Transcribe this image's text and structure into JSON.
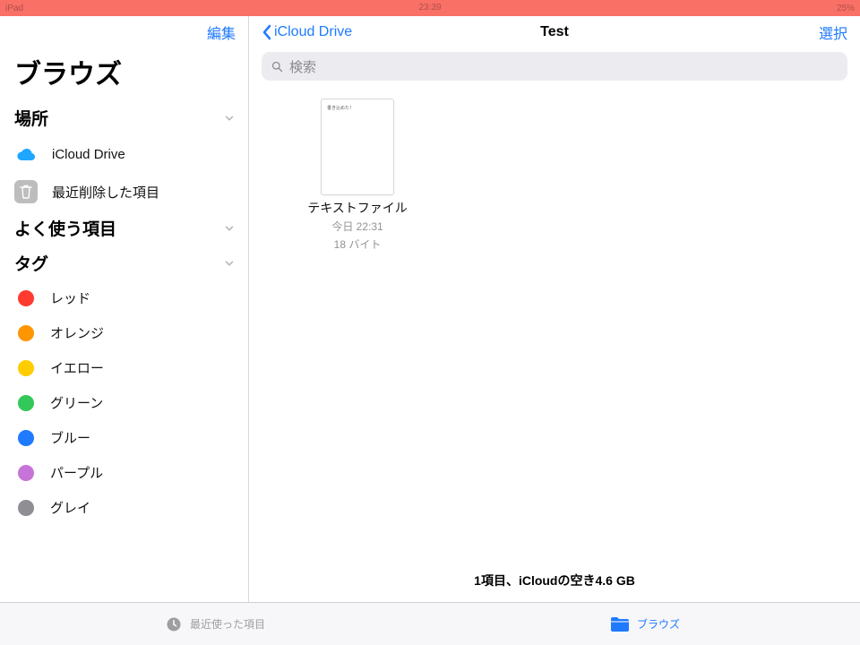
{
  "status": {
    "left": "iPad",
    "time": "23:39",
    "right": "25%"
  },
  "sidebar": {
    "edit_label": "編集",
    "title": "ブラウズ",
    "sections": {
      "locations": {
        "label": "場所"
      },
      "favorites": {
        "label": "よく使う項目"
      },
      "tags_section": {
        "label": "タグ"
      }
    },
    "locations_items": [
      {
        "label": "iCloud Drive"
      },
      {
        "label": "最近削除した項目"
      }
    ],
    "tags": [
      {
        "label": "レッド",
        "color": "#ff3b30"
      },
      {
        "label": "オレンジ",
        "color": "#ff9500"
      },
      {
        "label": "イエロー",
        "color": "#ffcc00"
      },
      {
        "label": "グリーン",
        "color": "#34c759"
      },
      {
        "label": "ブルー",
        "color": "#1f7aff"
      },
      {
        "label": "パープル",
        "color": "#c774d8"
      },
      {
        "label": "グレイ",
        "color": "#8e8e93"
      }
    ]
  },
  "main": {
    "back_label": "iCloud Drive",
    "title": "Test",
    "select_label": "選択",
    "search_placeholder": "検索",
    "file": {
      "name": "テキストファイル",
      "date": "今日 22:31",
      "size": "18 バイト",
      "preview_text": "書き込めた！"
    },
    "footer": "1項目、iCloudの空き4.6 GB"
  },
  "tabs": {
    "recent": "最近使った項目",
    "browse": "ブラウズ"
  }
}
